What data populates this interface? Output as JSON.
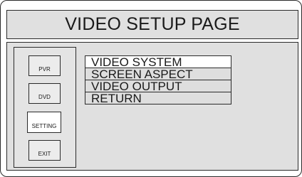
{
  "page": {
    "title": "VIDEO SETUP PAGE"
  },
  "sidebar": {
    "buttons": [
      {
        "label": "PVR"
      },
      {
        "label": "DVD"
      },
      {
        "label": "SETTING",
        "selected": true
      },
      {
        "label": "EXIT"
      }
    ]
  },
  "menu": {
    "items": [
      {
        "label": "VIDEO SYSTEM",
        "highlighted": true
      },
      {
        "label": "SCREEN ASPECT"
      },
      {
        "label": "VIDEO OUTPUT"
      },
      {
        "label": "RETURN"
      }
    ]
  },
  "colors": {
    "panel_background": "#e0e0e0",
    "border": "#2a2a2a",
    "highlight": "#ffffff"
  }
}
